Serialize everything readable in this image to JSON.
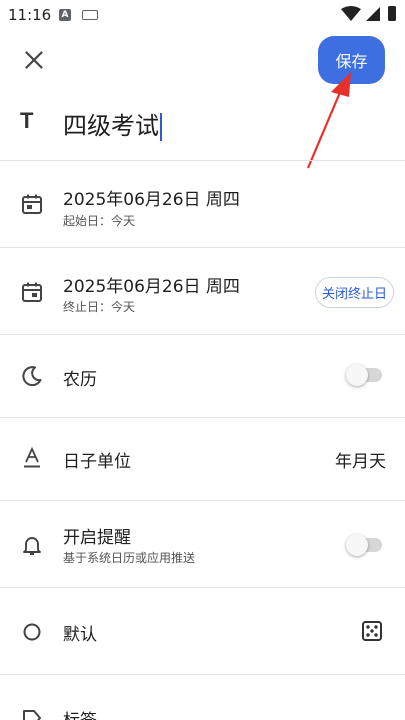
{
  "status_bar": {
    "time": "11:16",
    "app_icon": "a-letter-icon",
    "keyboard_icon": "keyboard-icon",
    "wifi_icon": "wifi-icon",
    "signal_icon": "signal-icon",
    "battery_icon": "battery-icon"
  },
  "toolbar": {
    "close_icon": "close-icon",
    "save_label": "保存",
    "save_color": "#3d6fe0"
  },
  "title_field": {
    "icon": "text-icon",
    "icon_glyph": "T",
    "value": "四级考试"
  },
  "start_date": {
    "icon": "calendar-icon",
    "date": "2025年06月26日 周四",
    "subtitle": "起始日：今天"
  },
  "end_date": {
    "icon": "calendar-icon",
    "date": "2025年06月26日 周四",
    "subtitle": "终止日：今天",
    "close_button": "关闭终止日"
  },
  "lunar": {
    "icon": "moon-icon",
    "label": "农历",
    "enabled": false
  },
  "day_unit": {
    "icon": "font-icon",
    "label": "日子单位",
    "value": "年月天"
  },
  "reminder": {
    "icon": "bell-icon",
    "label": "开启提醒",
    "subtitle": "基于系统日历或应用推送",
    "enabled": false
  },
  "default_style": {
    "icon": "circle-icon",
    "label": "默认",
    "right_icon": "dice-icon"
  },
  "tags": {
    "icon": "tag-icon",
    "label": "标签"
  },
  "accent_color": "#2b5bd7",
  "annotation_arrow_color": "#e8302a"
}
